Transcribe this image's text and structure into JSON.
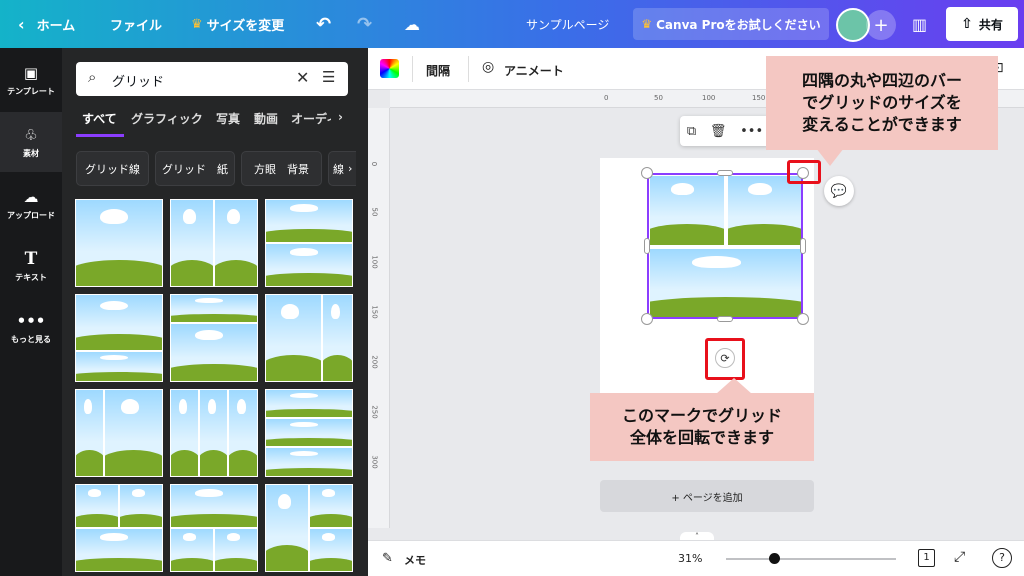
{
  "topbar": {
    "home": "ホーム",
    "file": "ファイル",
    "resize": "サイズを変更",
    "page_name": "サンプルページ",
    "pro": "Canva Proをお試しください",
    "share": "共有"
  },
  "rail": [
    {
      "label": "テンプレート",
      "icon": "layout-icon"
    },
    {
      "label": "素材",
      "icon": "shapes-icon"
    },
    {
      "label": "アップロード",
      "icon": "upload-icon"
    },
    {
      "label": "テキスト",
      "icon": "text-icon"
    },
    {
      "label": "もっと見る",
      "icon": "more-icon"
    }
  ],
  "search": {
    "value": "グリッド"
  },
  "tabs": [
    "すべて",
    "グラフィック",
    "写真",
    "動画",
    "オーディオ"
  ],
  "chips": [
    "グリッド線",
    "グリッド　紙",
    "方眼　背景",
    "線"
  ],
  "toolbar2": {
    "spacing": "間隔",
    "animate": "アニメート"
  },
  "ruler_h": [
    "0",
    "50",
    "100",
    "150"
  ],
  "ruler_v": [
    "0",
    "50",
    "100",
    "150",
    "200",
    "250",
    "300"
  ],
  "callouts": {
    "top": [
      "四隅の丸や四辺のバー",
      "でグリッドのサイズを",
      "変えることができます"
    ],
    "bottom": [
      "このマークでグリッド",
      "全体を回転できます"
    ]
  },
  "addpage": "+ ページを追加",
  "footer": {
    "memo": "メモ",
    "zoom": "31%",
    "page": "1",
    "help": "?"
  },
  "colors": {
    "accent": "#8b3dff",
    "callout_bg": "#f4c7c2",
    "red": "#e8101b"
  }
}
